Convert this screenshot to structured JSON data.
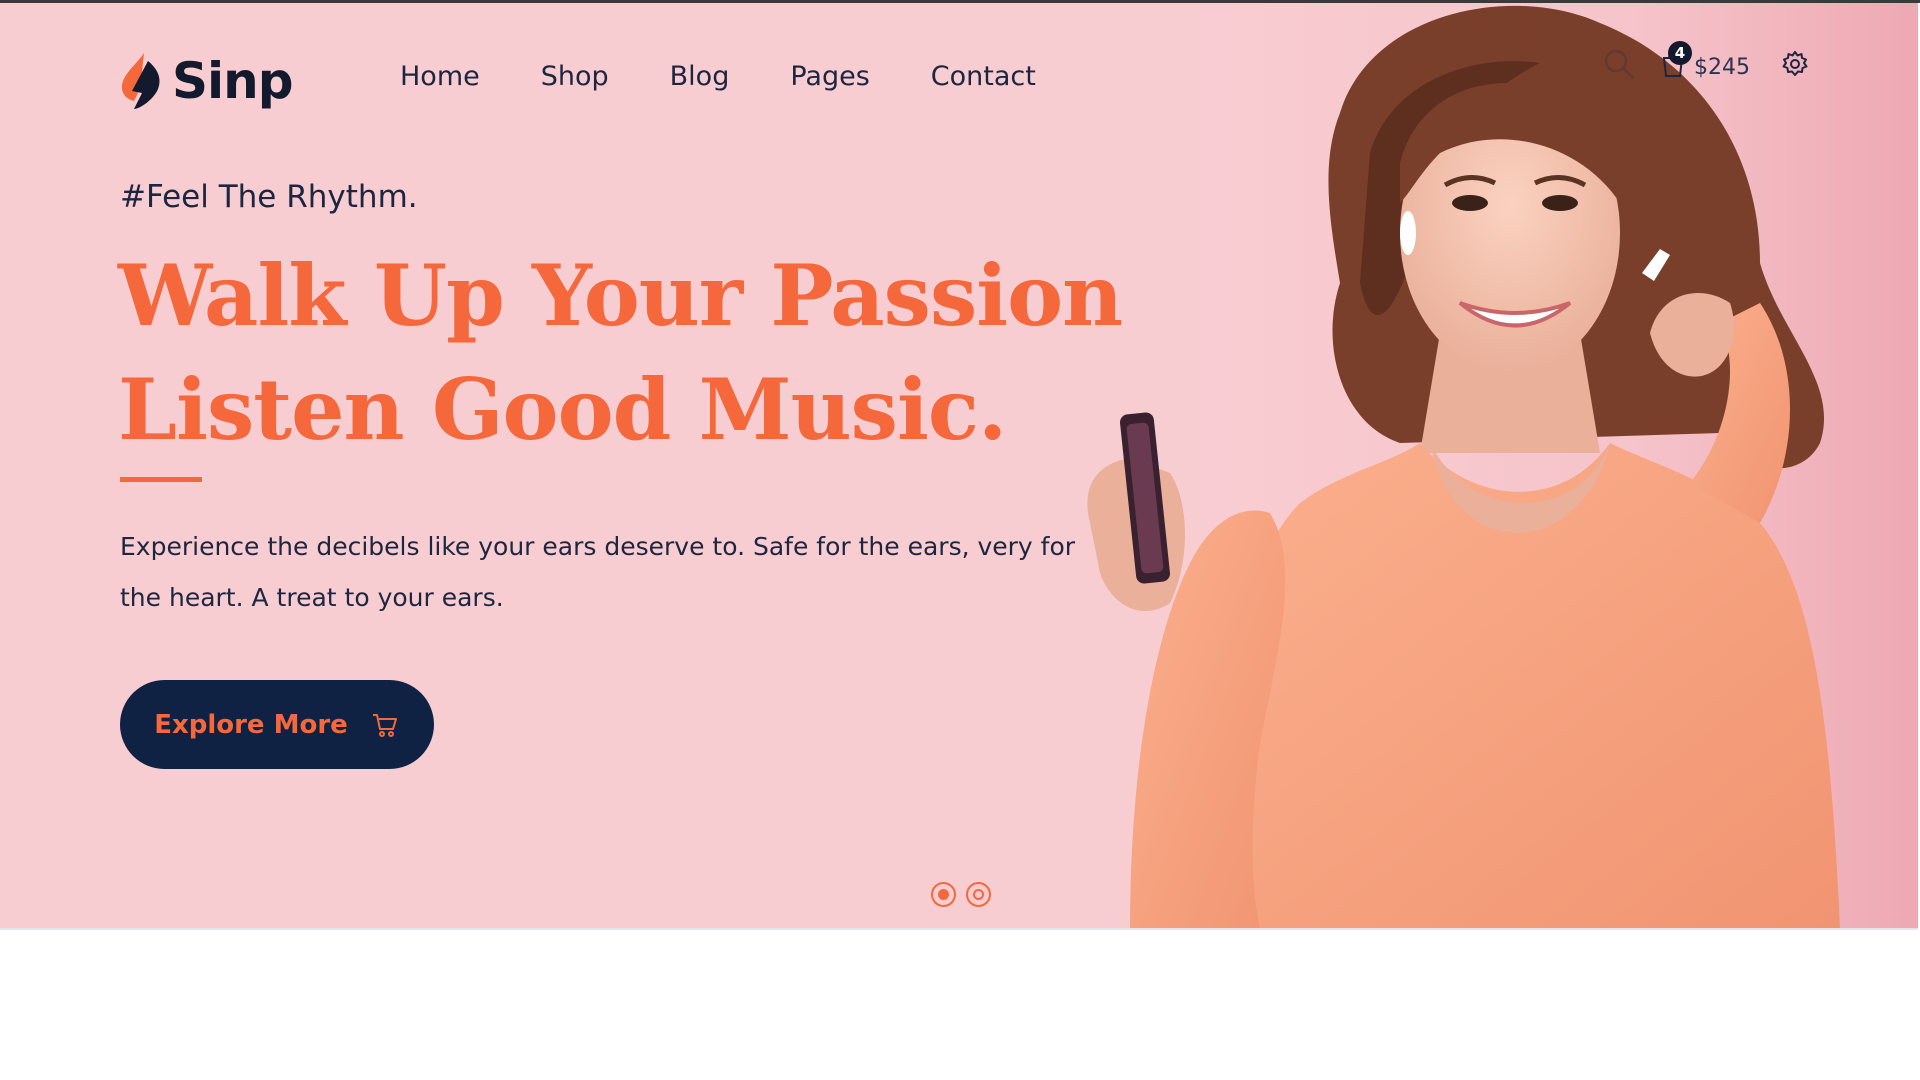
{
  "brand": {
    "name": "Sinp"
  },
  "nav": {
    "items": [
      {
        "label": "Home"
      },
      {
        "label": "Shop"
      },
      {
        "label": "Blog"
      },
      {
        "label": "Pages"
      },
      {
        "label": "Contact"
      }
    ]
  },
  "header": {
    "cart_count": "4",
    "cart_total": "$245",
    "icons": [
      "search-icon",
      "cart-icon",
      "gear-icon"
    ]
  },
  "hero": {
    "tagline": "#Feel The Rhythm.",
    "headline_line1": "Walk Up Your Passion",
    "headline_line2": "Listen Good Music.",
    "description": "Experience the decibels like your ears deserve to. Safe for the ears, very for the heart. A treat to your ears.",
    "cta_label": "Explore More",
    "slides": {
      "count": 2,
      "active": 1
    }
  },
  "colors": {
    "accent": "#f4683c",
    "navy": "#0f2244",
    "background": "#f8cdd2",
    "text": "#1d2640"
  }
}
